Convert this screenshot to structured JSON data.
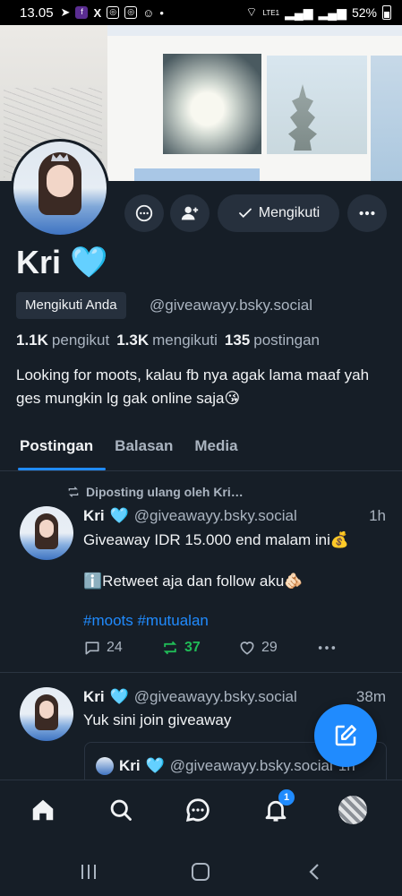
{
  "status_bar": {
    "time": "13.05",
    "battery": "52%",
    "network": "LTE1"
  },
  "profile": {
    "display_name": "Kri",
    "name_emoji": "🩵",
    "follows_you_label": "Mengikuti Anda",
    "handle": "@giveawayy.bsky.social",
    "follow_button_label": "Mengikuti",
    "followers_count": "1.1K",
    "followers_label": "pengikut",
    "following_count": "1.3K",
    "following_label": "mengikuti",
    "posts_count": "135",
    "posts_label": "postingan",
    "bio": "Looking for moots, kalau fb nya agak lama maaf yah ges mungkin lg gak online saja😘"
  },
  "tabs": [
    {
      "label": "Postingan",
      "active": true
    },
    {
      "label": "Balasan",
      "active": false
    },
    {
      "label": "Media",
      "active": false
    }
  ],
  "posts": [
    {
      "repost_label": "Diposting ulang oleh Kri…",
      "author": "Kri",
      "author_emoji": "🩵",
      "handle": "@giveawayy.bsky.social",
      "time": "1h",
      "line1": "Giveaway IDR 15.000 end malam ini💰",
      "line2": "ℹ️Retweet aja dan follow aku🫵🏻",
      "tags": "#moots #mutualan",
      "replies": "24",
      "reposts": "37",
      "likes": "29"
    },
    {
      "author": "Kri",
      "author_emoji": "🩵",
      "handle": "@giveawayy.bsky.social",
      "time": "38m",
      "line1": "Yuk sini join giveaway",
      "quote": {
        "author": "Kri",
        "author_emoji": "🩵",
        "handle": "@giveawayy.bsky.social",
        "time": "1h"
      }
    }
  ],
  "bottom_nav": {
    "notification_badge": "1"
  },
  "colors": {
    "background": "#161e27",
    "accent": "#208bfe",
    "repost_green": "#20bc57",
    "muted_text": "#aab4c0"
  }
}
